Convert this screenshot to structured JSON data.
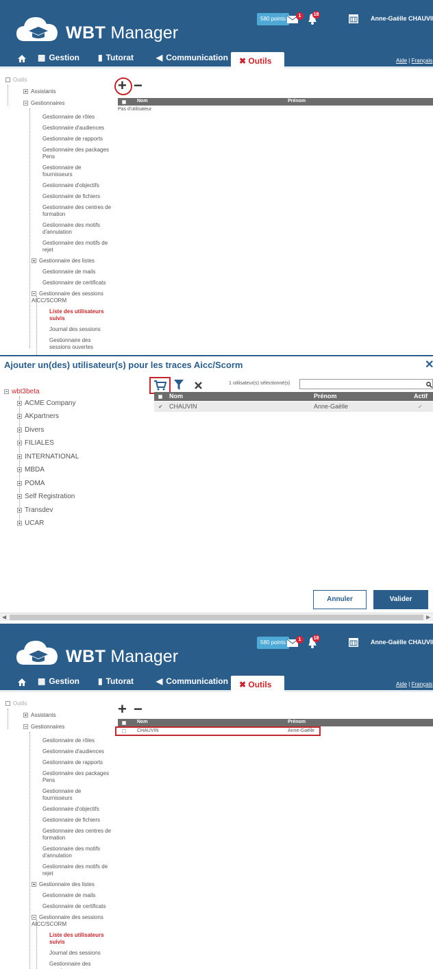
{
  "colors": {
    "brand": "#2a5d8a",
    "accent": "#c0262c",
    "points_badge": "#4ea9d6",
    "table_header": "#6c6c6c"
  },
  "header": {
    "logo_bold": "WBT",
    "logo_light": " Manager",
    "points": "580 points",
    "mail_badge": "1",
    "notif_badge": "18",
    "user": "Anne-Gaëlle CHAUVIN",
    "icons": [
      "mail-icon",
      "bell-icon",
      "calendar-icon"
    ]
  },
  "nav": {
    "home_icon": "home-icon",
    "gestion": "Gestion",
    "tutorat": "Tutorat",
    "communication": "Communication",
    "outils": "Outils",
    "aide": "Aide",
    "sep": "|",
    "lang": "Français"
  },
  "tree": {
    "root": "Outils",
    "assistants": "Assistants",
    "gestionnaires": "Gestionnaires",
    "items": [
      "Gestionnaire de rôles",
      "Gestionnaire d'audiences",
      "Gestionnaire de rapports",
      "Gestionnaire des packages Pens",
      "Gestionnaire de fournisseurs",
      "Gestionnaire d'objectifs",
      "Gestionnaire de fichiers",
      "Gestionnaire des centres de formation",
      "Gestionnaire des motifs d'annulation",
      "Gestionnaire des motifs de rejet",
      "Gestionnaire des listes",
      "Gestionnaire de mails",
      "Gestionnaire de certificats",
      "Gestionnaire des sessions AICC/SCORM"
    ],
    "sub_items": [
      "Liste des utilisateurs suivis",
      "Journal des sessions",
      "Gestionnaire des sessions ouvertes"
    ]
  },
  "list": {
    "add": "+",
    "remove": "−",
    "col_nom": "Nom",
    "col_prenom": "Prénom",
    "empty": "Pas d'utilisateur",
    "row_nom": "CHAUVIN",
    "row_prenom": "Anne-Gaëlle"
  },
  "dialog": {
    "title": "Ajouter un(des) utilisateur(s) pour les traces Aicc/Scorm",
    "close": "✕",
    "root_org": "wbt3beta",
    "orgs": [
      "ACME Company",
      "AKpartners",
      "Divers",
      "FILIALES",
      "INTERNATIONAL",
      "MBDA",
      "POMA",
      "Self Registration",
      "Transdev",
      "UCAR"
    ],
    "selected_count": "1 utilisateur(s) sélectionné(s)",
    "search_value": "",
    "col_nom": "Nom",
    "col_prenom": "Prénom",
    "col_actif": "Actif",
    "row_nom": "CHAUVIN",
    "row_prenom": "Anne-Gaëlle",
    "cancel": "Annuler",
    "ok": "Valider"
  }
}
